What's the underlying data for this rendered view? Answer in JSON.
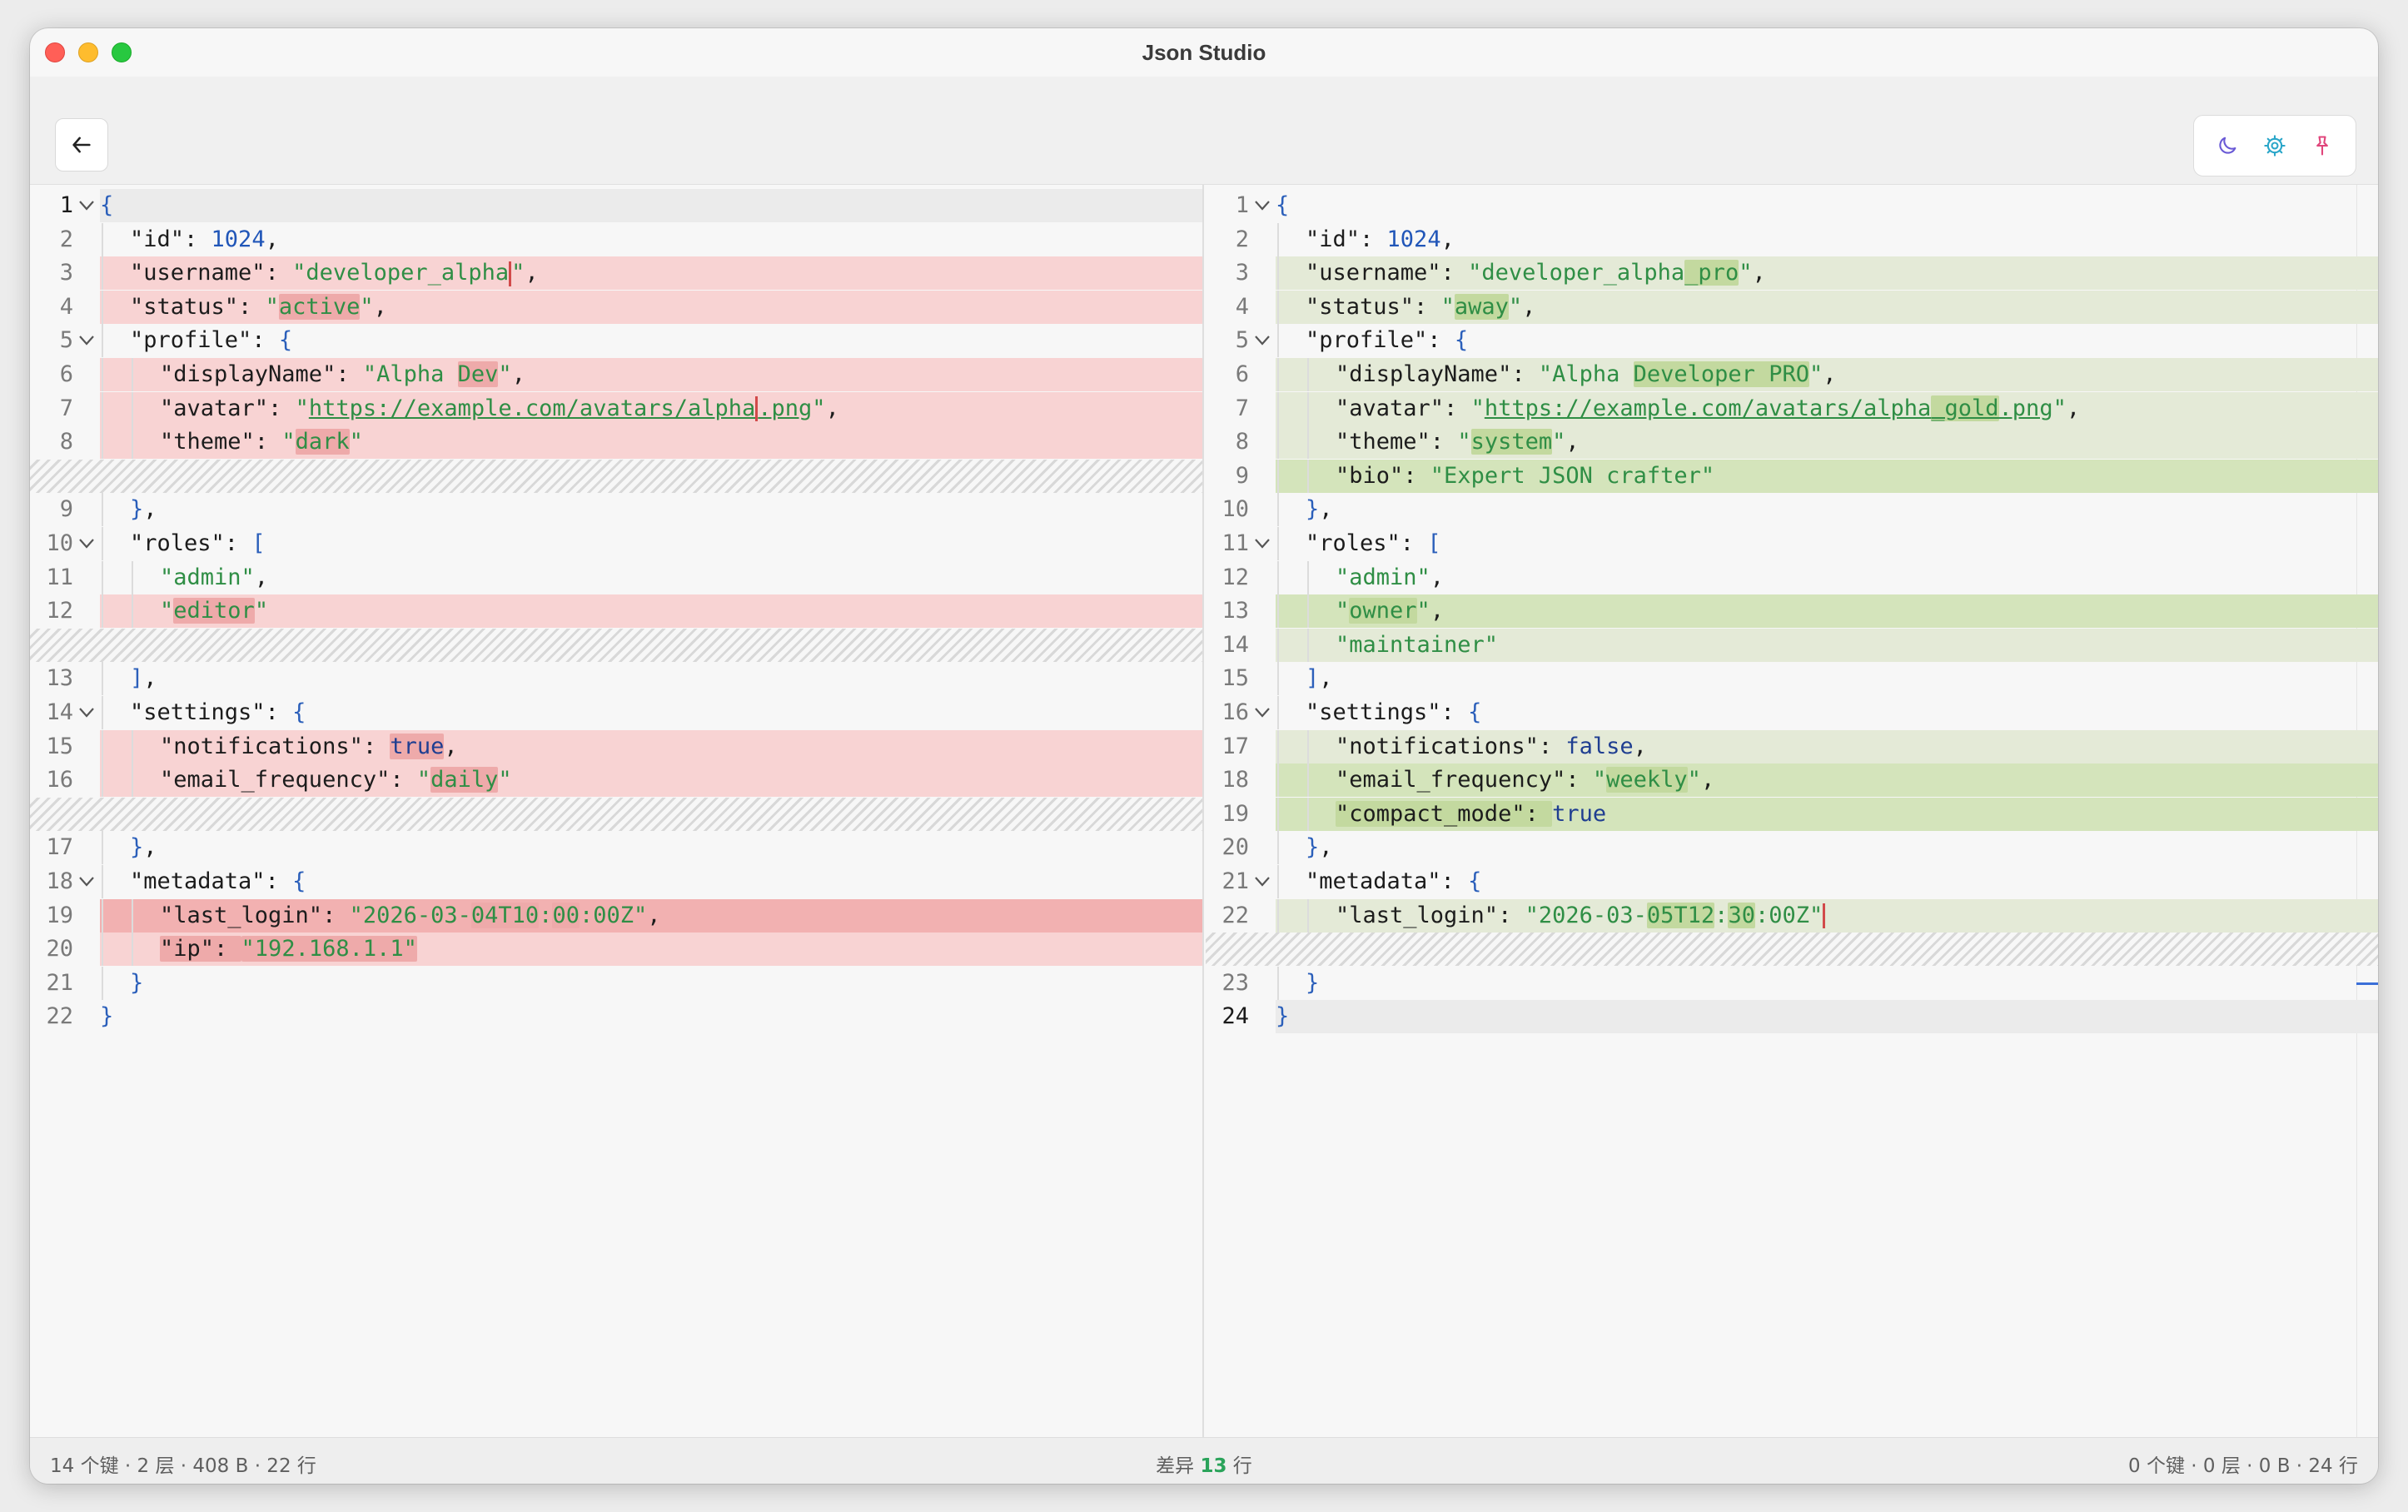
{
  "window": {
    "title": "Json Studio"
  },
  "toolbar": {
    "back_icon": "arrow-left-icon",
    "theme_icon": "moon-icon",
    "settings_icon": "gear-icon",
    "pin_icon": "pin-icon"
  },
  "colors": {
    "deleted_line": "#f8d3d3",
    "added_line": "#e4ead7",
    "string": "#2f8e45",
    "number": "#2156b8",
    "pin": "#e0457b",
    "settings": "#2aa6c9",
    "theme": "#6a5ad6"
  },
  "left_lines": [
    {
      "n": "1",
      "fold": true,
      "bg": "active",
      "indent": 0,
      "cur": true,
      "t": [
        {
          "c": "p",
          "v": "{"
        }
      ]
    },
    {
      "n": "2",
      "indent": 1,
      "t": [
        {
          "c": "k",
          "v": "\"id\": "
        },
        {
          "c": "n",
          "v": "1024"
        },
        {
          "c": "k",
          "v": ","
        }
      ]
    },
    {
      "n": "3",
      "bg": "del",
      "indent": 1,
      "t": [
        {
          "c": "k",
          "v": "\"username\": "
        },
        {
          "c": "s",
          "v": "\"developer_alpha"
        },
        {
          "c": "caret",
          "v": ""
        },
        {
          "c": "s",
          "v": "\""
        },
        {
          "c": "k",
          "v": ","
        }
      ]
    },
    {
      "n": "4",
      "bg": "del",
      "indent": 1,
      "t": [
        {
          "c": "k",
          "v": "\"status\": "
        },
        {
          "c": "s",
          "v": "\""
        },
        {
          "c": "s hl-del",
          "v": "active"
        },
        {
          "c": "s",
          "v": "\""
        },
        {
          "c": "k",
          "v": ","
        }
      ]
    },
    {
      "n": "5",
      "fold": true,
      "indent": 1,
      "t": [
        {
          "c": "k",
          "v": "\"profile\": "
        },
        {
          "c": "p",
          "v": "{"
        }
      ]
    },
    {
      "n": "6",
      "bg": "del",
      "indent": 2,
      "t": [
        {
          "c": "k",
          "v": "\"displayName\": "
        },
        {
          "c": "s",
          "v": "\"Alpha "
        },
        {
          "c": "s hl-del",
          "v": "Dev"
        },
        {
          "c": "s",
          "v": "\""
        },
        {
          "c": "k",
          "v": ","
        }
      ]
    },
    {
      "n": "7",
      "bg": "del",
      "indent": 2,
      "t": [
        {
          "c": "k",
          "v": "\"avatar\": "
        },
        {
          "c": "s",
          "v": "\""
        },
        {
          "c": "s u",
          "v": "https://example.com/avatars/alpha"
        },
        {
          "c": "caret",
          "v": ""
        },
        {
          "c": "s u",
          "v": ".png"
        },
        {
          "c": "s",
          "v": "\""
        },
        {
          "c": "k",
          "v": ","
        }
      ]
    },
    {
      "n": "8",
      "bg": "del",
      "indent": 2,
      "t": [
        {
          "c": "k",
          "v": "\"theme\": "
        },
        {
          "c": "s",
          "v": "\""
        },
        {
          "c": "s hl-del",
          "v": "dark"
        },
        {
          "c": "s",
          "v": "\""
        }
      ]
    },
    {
      "n": "",
      "bg": "hatch",
      "indent": 0,
      "t": []
    },
    {
      "n": "9",
      "indent": 1,
      "t": [
        {
          "c": "p",
          "v": "}"
        },
        {
          "c": "k",
          "v": ","
        }
      ]
    },
    {
      "n": "10",
      "fold": true,
      "indent": 1,
      "t": [
        {
          "c": "k",
          "v": "\"roles\": "
        },
        {
          "c": "p",
          "v": "["
        }
      ]
    },
    {
      "n": "11",
      "indent": 2,
      "t": [
        {
          "c": "s",
          "v": "\"admin\""
        },
        {
          "c": "k",
          "v": ","
        }
      ]
    },
    {
      "n": "12",
      "bg": "del",
      "indent": 2,
      "t": [
        {
          "c": "s",
          "v": "\""
        },
        {
          "c": "s hl-del",
          "v": "editor"
        },
        {
          "c": "s",
          "v": "\""
        }
      ]
    },
    {
      "n": "",
      "bg": "hatch",
      "indent": 0,
      "t": []
    },
    {
      "n": "13",
      "indent": 1,
      "t": [
        {
          "c": "p",
          "v": "]"
        },
        {
          "c": "k",
          "v": ","
        }
      ]
    },
    {
      "n": "14",
      "fold": true,
      "indent": 1,
      "t": [
        {
          "c": "k",
          "v": "\"settings\": "
        },
        {
          "c": "p",
          "v": "{"
        }
      ]
    },
    {
      "n": "15",
      "bg": "del",
      "indent": 2,
      "t": [
        {
          "c": "k",
          "v": "\"notifications\": "
        },
        {
          "c": "b hl-del",
          "v": "true"
        },
        {
          "c": "k",
          "v": ","
        }
      ]
    },
    {
      "n": "16",
      "bg": "del",
      "indent": 2,
      "t": [
        {
          "c": "k",
          "v": "\"email_frequency\": "
        },
        {
          "c": "s",
          "v": "\""
        },
        {
          "c": "s hl-del",
          "v": "daily"
        },
        {
          "c": "s",
          "v": "\""
        }
      ]
    },
    {
      "n": "",
      "bg": "hatch",
      "indent": 0,
      "t": []
    },
    {
      "n": "17",
      "indent": 1,
      "t": [
        {
          "c": "p",
          "v": "}"
        },
        {
          "c": "k",
          "v": ","
        }
      ]
    },
    {
      "n": "18",
      "fold": true,
      "indent": 1,
      "t": [
        {
          "c": "k",
          "v": "\"metadata\": "
        },
        {
          "c": "p",
          "v": "{"
        }
      ]
    },
    {
      "n": "19",
      "bg": "del-strong",
      "indent": 2,
      "t": [
        {
          "c": "k",
          "v": "\"last_login\": "
        },
        {
          "c": "s",
          "v": "\"2026-03-"
        },
        {
          "c": "s hl-del",
          "v": "04T10"
        },
        {
          "c": "s",
          "v": ":"
        },
        {
          "c": "s hl-del",
          "v": "00"
        },
        {
          "c": "s",
          "v": ":00Z\""
        },
        {
          "c": "k",
          "v": ","
        }
      ]
    },
    {
      "n": "20",
      "bg": "del",
      "indent": 2,
      "t": [
        {
          "c": "k hl-del",
          "v": "\"ip\": "
        },
        {
          "c": "s hl-del",
          "v": "\"192.168.1.1\""
        }
      ]
    },
    {
      "n": "21",
      "indent": 1,
      "t": [
        {
          "c": "p",
          "v": "}"
        }
      ]
    },
    {
      "n": "22",
      "indent": 0,
      "t": [
        {
          "c": "p",
          "v": "}"
        }
      ]
    }
  ],
  "right_lines": [
    {
      "n": "1",
      "fold": true,
      "indent": 0,
      "t": [
        {
          "c": "p",
          "v": "{"
        }
      ]
    },
    {
      "n": "2",
      "indent": 1,
      "t": [
        {
          "c": "k",
          "v": "\"id\": "
        },
        {
          "c": "n",
          "v": "1024"
        },
        {
          "c": "k",
          "v": ","
        }
      ]
    },
    {
      "n": "3",
      "bg": "add",
      "indent": 1,
      "t": [
        {
          "c": "k",
          "v": "\"username\": "
        },
        {
          "c": "s",
          "v": "\"developer_alpha"
        },
        {
          "c": "s hl-add",
          "v": "_pro"
        },
        {
          "c": "s",
          "v": "\""
        },
        {
          "c": "k",
          "v": ","
        }
      ]
    },
    {
      "n": "4",
      "bg": "add",
      "indent": 1,
      "t": [
        {
          "c": "k",
          "v": "\"status\": "
        },
        {
          "c": "s",
          "v": "\""
        },
        {
          "c": "s hl-add",
          "v": "away"
        },
        {
          "c": "s",
          "v": "\""
        },
        {
          "c": "k",
          "v": ","
        }
      ]
    },
    {
      "n": "5",
      "fold": true,
      "indent": 1,
      "t": [
        {
          "c": "k",
          "v": "\"profile\": "
        },
        {
          "c": "p",
          "v": "{"
        }
      ]
    },
    {
      "n": "6",
      "bg": "add",
      "indent": 2,
      "t": [
        {
          "c": "k",
          "v": "\"displayName\": "
        },
        {
          "c": "s",
          "v": "\"Alpha "
        },
        {
          "c": "s hl-add",
          "v": "Developer PRO"
        },
        {
          "c": "s",
          "v": "\""
        },
        {
          "c": "k",
          "v": ","
        }
      ]
    },
    {
      "n": "7",
      "bg": "add",
      "indent": 2,
      "t": [
        {
          "c": "k",
          "v": "\"avatar\": "
        },
        {
          "c": "s",
          "v": "\""
        },
        {
          "c": "s u",
          "v": "https://example.com/avatars/alpha"
        },
        {
          "c": "s u hl-add",
          "v": "_gold"
        },
        {
          "c": "s u",
          "v": ".png"
        },
        {
          "c": "s",
          "v": "\""
        },
        {
          "c": "k",
          "v": ","
        }
      ]
    },
    {
      "n": "8",
      "bg": "add",
      "indent": 2,
      "t": [
        {
          "c": "k",
          "v": "\"theme\": "
        },
        {
          "c": "s",
          "v": "\""
        },
        {
          "c": "s hl-add",
          "v": "system"
        },
        {
          "c": "s",
          "v": "\""
        },
        {
          "c": "k",
          "v": ","
        }
      ]
    },
    {
      "n": "9",
      "bg": "add-strong",
      "indent": 2,
      "t": [
        {
          "c": "k",
          "v": "\"bio\": "
        },
        {
          "c": "s",
          "v": "\"Expert JSON crafter\""
        }
      ]
    },
    {
      "n": "10",
      "indent": 1,
      "t": [
        {
          "c": "p",
          "v": "}"
        },
        {
          "c": "k",
          "v": ","
        }
      ]
    },
    {
      "n": "11",
      "fold": true,
      "indent": 1,
      "t": [
        {
          "c": "k",
          "v": "\"roles\": "
        },
        {
          "c": "p",
          "v": "["
        }
      ]
    },
    {
      "n": "12",
      "indent": 2,
      "t": [
        {
          "c": "s",
          "v": "\"admin\""
        },
        {
          "c": "k",
          "v": ","
        }
      ]
    },
    {
      "n": "13",
      "bg": "add-strong",
      "indent": 2,
      "t": [
        {
          "c": "s",
          "v": "\""
        },
        {
          "c": "s hl-add",
          "v": "owner"
        },
        {
          "c": "s",
          "v": "\""
        },
        {
          "c": "k",
          "v": ","
        }
      ]
    },
    {
      "n": "14",
      "bg": "add",
      "indent": 2,
      "t": [
        {
          "c": "s",
          "v": "\"maintainer\""
        }
      ]
    },
    {
      "n": "15",
      "indent": 1,
      "t": [
        {
          "c": "p",
          "v": "]"
        },
        {
          "c": "k",
          "v": ","
        }
      ]
    },
    {
      "n": "16",
      "fold": true,
      "indent": 1,
      "t": [
        {
          "c": "k",
          "v": "\"settings\": "
        },
        {
          "c": "p",
          "v": "{"
        }
      ]
    },
    {
      "n": "17",
      "bg": "add",
      "indent": 2,
      "t": [
        {
          "c": "k",
          "v": "\"notifications\": "
        },
        {
          "c": "b",
          "v": "false"
        },
        {
          "c": "k",
          "v": ","
        }
      ]
    },
    {
      "n": "18",
      "bg": "add-strong",
      "indent": 2,
      "t": [
        {
          "c": "k",
          "v": "\"email_frequency\": "
        },
        {
          "c": "s",
          "v": "\""
        },
        {
          "c": "s hl-add",
          "v": "weekly"
        },
        {
          "c": "s",
          "v": "\""
        },
        {
          "c": "k",
          "v": ","
        }
      ]
    },
    {
      "n": "19",
      "bg": "add-strong",
      "indent": 2,
      "t": [
        {
          "c": "k hl-add",
          "v": "\"compact_mode\": "
        },
        {
          "c": "b",
          "v": "true"
        }
      ]
    },
    {
      "n": "20",
      "indent": 1,
      "t": [
        {
          "c": "p",
          "v": "}"
        },
        {
          "c": "k",
          "v": ","
        }
      ]
    },
    {
      "n": "21",
      "fold": true,
      "indent": 1,
      "t": [
        {
          "c": "k",
          "v": "\"metadata\": "
        },
        {
          "c": "p",
          "v": "{"
        }
      ]
    },
    {
      "n": "22",
      "bg": "add",
      "indent": 2,
      "t": [
        {
          "c": "k",
          "v": "\"last_login\": "
        },
        {
          "c": "s",
          "v": "\"2026-03-"
        },
        {
          "c": "s hl-add",
          "v": "05T12"
        },
        {
          "c": "s",
          "v": ":"
        },
        {
          "c": "s hl-add",
          "v": "30"
        },
        {
          "c": "s",
          "v": ":00Z\""
        },
        {
          "c": "caret",
          "v": ""
        }
      ]
    },
    {
      "n": "",
      "bg": "hatch",
      "indent": 0,
      "t": []
    },
    {
      "n": "23",
      "indent": 1,
      "t": [
        {
          "c": "p",
          "v": "}"
        }
      ]
    },
    {
      "n": "24",
      "bg": "active",
      "cur": true,
      "indent": 0,
      "t": [
        {
          "c": "p",
          "v": "}"
        }
      ]
    }
  ],
  "status": {
    "left": "14 个键 · 2 层 · 408 B · 22 行",
    "diff_prefix": "差异 ",
    "diff_count": "13",
    "diff_suffix": " 行",
    "right": "0 个键 · 0 层 · 0 B · 24 行"
  }
}
